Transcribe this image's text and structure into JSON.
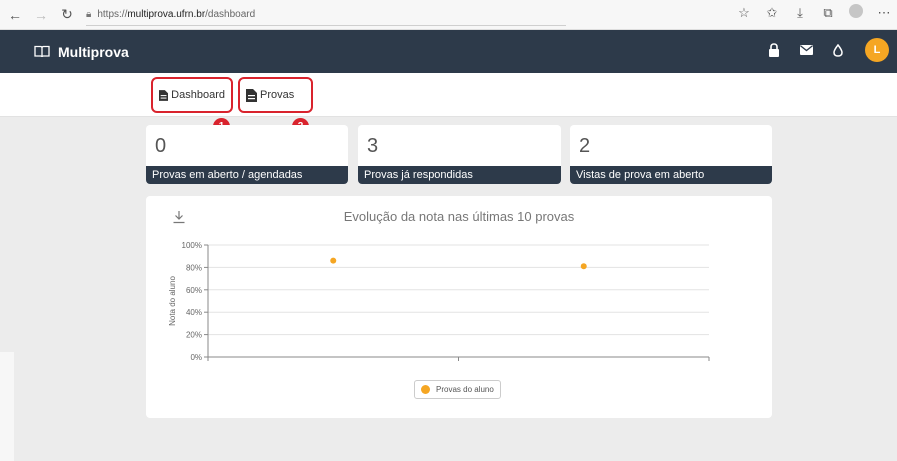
{
  "browser": {
    "url_prefix": "https://",
    "url_host": "multiprova.ufrn.br",
    "url_path": "/dashboard"
  },
  "app": {
    "brand": "Multiprova",
    "avatar_initial": "L",
    "accent": "#f5a623",
    "header_bg": "#2d3a4a"
  },
  "nav": {
    "dashboard": "Dashboard",
    "provas": "Provas"
  },
  "annotations": [
    "1",
    "2"
  ],
  "stats": [
    {
      "value": "0",
      "label": "Provas em aberto / agendadas"
    },
    {
      "value": "3",
      "label": "Provas já respondidas"
    },
    {
      "value": "2",
      "label": "Vistas de prova em aberto"
    }
  ],
  "chart_data": {
    "type": "scatter",
    "title": "Evolução da nota nas últimas 10 provas",
    "ylabel": "Nota do aluno",
    "xlabel": "",
    "ylim": [
      0,
      100
    ],
    "yticks": [
      "100%",
      "80%",
      "60%",
      "40%",
      "20%",
      "0%"
    ],
    "x": [
      1,
      2
    ],
    "series": [
      {
        "name": "Provas do aluno",
        "values": [
          86,
          81
        ],
        "color": "#f5a623"
      }
    ],
    "grid": true,
    "legend_position": "bottom"
  }
}
